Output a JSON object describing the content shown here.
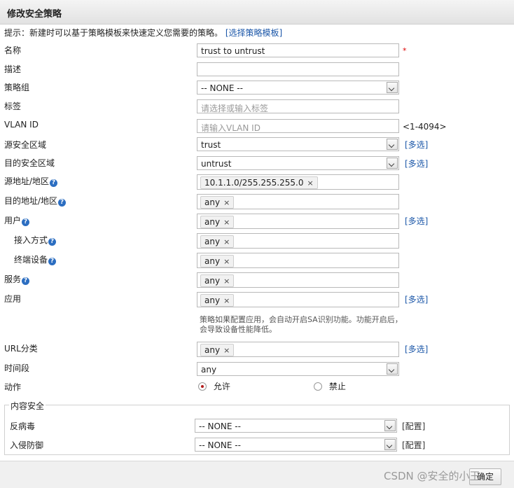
{
  "dialog": {
    "title": "修改安全策略"
  },
  "hint": {
    "text": "提示：新建时可以基于策略模板来快速定义您需要的策略。",
    "link": "[选择策略模板]"
  },
  "fields": {
    "name": {
      "label": "名称",
      "value": "trust to untrust",
      "required_mark": "*"
    },
    "desc": {
      "label": "描述",
      "value": ""
    },
    "group": {
      "label": "策略组",
      "value": "-- NONE --"
    },
    "tag": {
      "label": "标签",
      "placeholder": "请选择或输入标签"
    },
    "vlan": {
      "label": "VLAN ID",
      "placeholder": "请输入VLAN ID",
      "range": "<1-4094>"
    },
    "src_zone": {
      "label": "源安全区域",
      "value": "trust",
      "more": "[多选]"
    },
    "dst_zone": {
      "label": "目的安全区域",
      "value": "untrust",
      "more": "[多选]"
    },
    "src_addr": {
      "label": "源地址/地区",
      "tag": "10.1.1.0/255.255.255.0"
    },
    "dst_addr": {
      "label": "目的地址/地区",
      "tag": "any"
    },
    "user": {
      "label": "用户",
      "tag": "any",
      "more": "[多选]"
    },
    "access": {
      "label": "接入方式",
      "tag": "any"
    },
    "device": {
      "label": "终端设备",
      "tag": "any"
    },
    "service": {
      "label": "服务",
      "tag": "any"
    },
    "app": {
      "label": "应用",
      "tag": "any",
      "more": "[多选]",
      "note": "策略如果配置应用，会自动开启SA识别功能。功能开启后，会导致设备性能降低。"
    },
    "url": {
      "label": "URL分类",
      "tag": "any",
      "more": "[多选]"
    },
    "time": {
      "label": "时间段",
      "value": "any"
    },
    "action": {
      "label": "动作",
      "allow": "允许",
      "deny": "禁止"
    }
  },
  "content_security": {
    "legend": "内容安全",
    "antivirus": {
      "label": "反病毒",
      "value": "-- NONE --",
      "config": "[配置]"
    },
    "ips": {
      "label": "入侵防御",
      "value": "-- NONE --",
      "config": "[配置]"
    }
  },
  "footer": {
    "ok": "确定"
  },
  "watermark": "CSDN @安全的小王"
}
